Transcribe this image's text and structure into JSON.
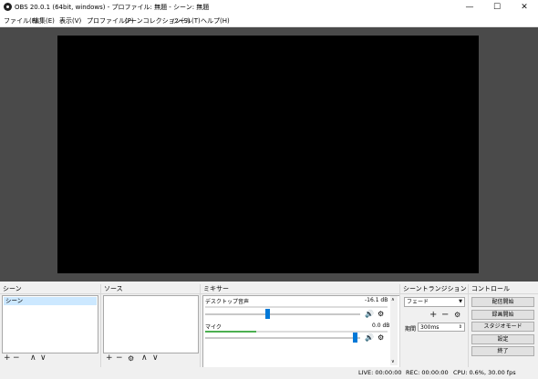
{
  "window": {
    "title": "OBS 20.0.1 (64bit, windows) - プロファイル: 無題 - シーン: 無題",
    "minimize": "—",
    "maximize": "☐",
    "close": "✕"
  },
  "menu": [
    "ファイル(F)",
    "編集(E)",
    "表示(V)",
    "プロファイル(P)",
    "シーンコレクション(S)",
    "ツール(T)",
    "ヘルプ(H)"
  ],
  "scenes": {
    "title": "シーン",
    "items": [
      "シーン"
    ],
    "add": "+",
    "remove": "−",
    "up": "∧",
    "down": "∨"
  },
  "sources": {
    "title": "ソース",
    "add": "+",
    "remove": "−",
    "settings": "⚙",
    "up": "∧",
    "down": "∨"
  },
  "mixer": {
    "title": "ミキサー",
    "tracks": [
      {
        "name": "デスクトップ音声",
        "db": "-16.1 dB",
        "meter_level": 0.0,
        "volume": 0.42
      },
      {
        "name": "マイク",
        "db": "0.0 dB",
        "meter_level": 0.28,
        "volume": 0.98
      }
    ]
  },
  "transitions": {
    "title": "シーントランジション",
    "selected": "フェード",
    "add": "+",
    "remove": "−",
    "settings": "⚙",
    "duration_label": "期間",
    "duration_value": "300ms"
  },
  "controls": {
    "title": "コントロール",
    "buttons": [
      "配信開始",
      "録画開始",
      "スタジオモード",
      "設定",
      "終了"
    ]
  },
  "status": {
    "live": "LIVE: 00:00:00",
    "rec": "REC: 00:00:00",
    "cpu": "CPU: 0.6%, 30.00 fps"
  }
}
